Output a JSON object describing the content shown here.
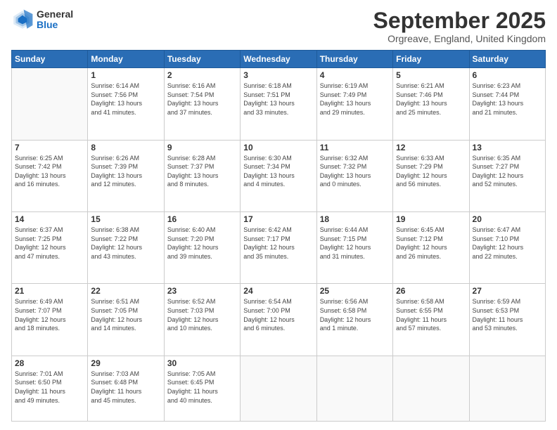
{
  "logo": {
    "general": "General",
    "blue": "Blue"
  },
  "header": {
    "month": "September 2025",
    "location": "Orgreave, England, United Kingdom"
  },
  "weekdays": [
    "Sunday",
    "Monday",
    "Tuesday",
    "Wednesday",
    "Thursday",
    "Friday",
    "Saturday"
  ],
  "weeks": [
    [
      {
        "day": "",
        "info": ""
      },
      {
        "day": "1",
        "info": "Sunrise: 6:14 AM\nSunset: 7:56 PM\nDaylight: 13 hours\nand 41 minutes."
      },
      {
        "day": "2",
        "info": "Sunrise: 6:16 AM\nSunset: 7:54 PM\nDaylight: 13 hours\nand 37 minutes."
      },
      {
        "day": "3",
        "info": "Sunrise: 6:18 AM\nSunset: 7:51 PM\nDaylight: 13 hours\nand 33 minutes."
      },
      {
        "day": "4",
        "info": "Sunrise: 6:19 AM\nSunset: 7:49 PM\nDaylight: 13 hours\nand 29 minutes."
      },
      {
        "day": "5",
        "info": "Sunrise: 6:21 AM\nSunset: 7:46 PM\nDaylight: 13 hours\nand 25 minutes."
      },
      {
        "day": "6",
        "info": "Sunrise: 6:23 AM\nSunset: 7:44 PM\nDaylight: 13 hours\nand 21 minutes."
      }
    ],
    [
      {
        "day": "7",
        "info": "Sunrise: 6:25 AM\nSunset: 7:42 PM\nDaylight: 13 hours\nand 16 minutes."
      },
      {
        "day": "8",
        "info": "Sunrise: 6:26 AM\nSunset: 7:39 PM\nDaylight: 13 hours\nand 12 minutes."
      },
      {
        "day": "9",
        "info": "Sunrise: 6:28 AM\nSunset: 7:37 PM\nDaylight: 13 hours\nand 8 minutes."
      },
      {
        "day": "10",
        "info": "Sunrise: 6:30 AM\nSunset: 7:34 PM\nDaylight: 13 hours\nand 4 minutes."
      },
      {
        "day": "11",
        "info": "Sunrise: 6:32 AM\nSunset: 7:32 PM\nDaylight: 13 hours\nand 0 minutes."
      },
      {
        "day": "12",
        "info": "Sunrise: 6:33 AM\nSunset: 7:29 PM\nDaylight: 12 hours\nand 56 minutes."
      },
      {
        "day": "13",
        "info": "Sunrise: 6:35 AM\nSunset: 7:27 PM\nDaylight: 12 hours\nand 52 minutes."
      }
    ],
    [
      {
        "day": "14",
        "info": "Sunrise: 6:37 AM\nSunset: 7:25 PM\nDaylight: 12 hours\nand 47 minutes."
      },
      {
        "day": "15",
        "info": "Sunrise: 6:38 AM\nSunset: 7:22 PM\nDaylight: 12 hours\nand 43 minutes."
      },
      {
        "day": "16",
        "info": "Sunrise: 6:40 AM\nSunset: 7:20 PM\nDaylight: 12 hours\nand 39 minutes."
      },
      {
        "day": "17",
        "info": "Sunrise: 6:42 AM\nSunset: 7:17 PM\nDaylight: 12 hours\nand 35 minutes."
      },
      {
        "day": "18",
        "info": "Sunrise: 6:44 AM\nSunset: 7:15 PM\nDaylight: 12 hours\nand 31 minutes."
      },
      {
        "day": "19",
        "info": "Sunrise: 6:45 AM\nSunset: 7:12 PM\nDaylight: 12 hours\nand 26 minutes."
      },
      {
        "day": "20",
        "info": "Sunrise: 6:47 AM\nSunset: 7:10 PM\nDaylight: 12 hours\nand 22 minutes."
      }
    ],
    [
      {
        "day": "21",
        "info": "Sunrise: 6:49 AM\nSunset: 7:07 PM\nDaylight: 12 hours\nand 18 minutes."
      },
      {
        "day": "22",
        "info": "Sunrise: 6:51 AM\nSunset: 7:05 PM\nDaylight: 12 hours\nand 14 minutes."
      },
      {
        "day": "23",
        "info": "Sunrise: 6:52 AM\nSunset: 7:03 PM\nDaylight: 12 hours\nand 10 minutes."
      },
      {
        "day": "24",
        "info": "Sunrise: 6:54 AM\nSunset: 7:00 PM\nDaylight: 12 hours\nand 6 minutes."
      },
      {
        "day": "25",
        "info": "Sunrise: 6:56 AM\nSunset: 6:58 PM\nDaylight: 12 hours\nand 1 minute."
      },
      {
        "day": "26",
        "info": "Sunrise: 6:58 AM\nSunset: 6:55 PM\nDaylight: 11 hours\nand 57 minutes."
      },
      {
        "day": "27",
        "info": "Sunrise: 6:59 AM\nSunset: 6:53 PM\nDaylight: 11 hours\nand 53 minutes."
      }
    ],
    [
      {
        "day": "28",
        "info": "Sunrise: 7:01 AM\nSunset: 6:50 PM\nDaylight: 11 hours\nand 49 minutes."
      },
      {
        "day": "29",
        "info": "Sunrise: 7:03 AM\nSunset: 6:48 PM\nDaylight: 11 hours\nand 45 minutes."
      },
      {
        "day": "30",
        "info": "Sunrise: 7:05 AM\nSunset: 6:45 PM\nDaylight: 11 hours\nand 40 minutes."
      },
      {
        "day": "",
        "info": ""
      },
      {
        "day": "",
        "info": ""
      },
      {
        "day": "",
        "info": ""
      },
      {
        "day": "",
        "info": ""
      }
    ]
  ]
}
